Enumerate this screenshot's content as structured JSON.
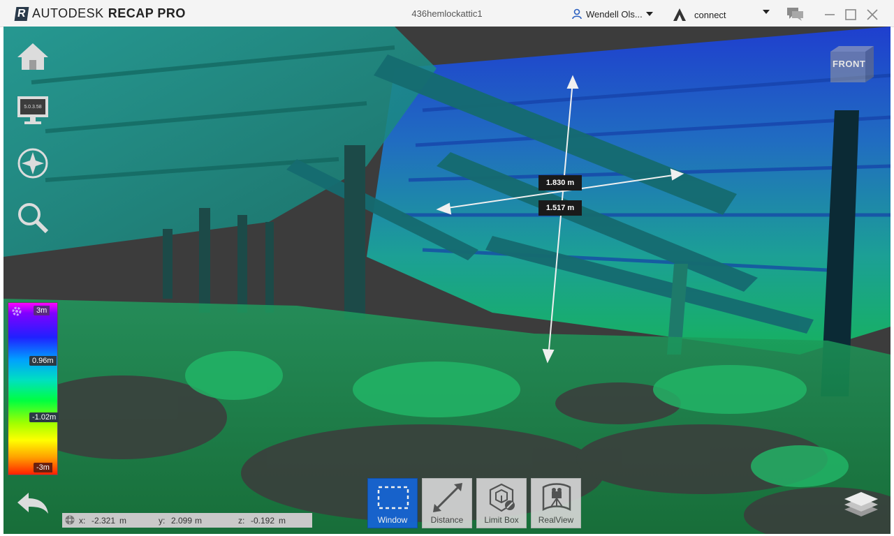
{
  "app": {
    "brand_logo": "R",
    "brand_primary": "AUTODESK",
    "brand_secondary": "RECAP PRO",
    "document_title": "436hemlockattic1"
  },
  "account": {
    "user_name": "Wendell Ols...",
    "connect_label": "connect"
  },
  "window_controls": [
    "minimize-icon",
    "maximize-icon",
    "close-icon"
  ],
  "left_toolbar": {
    "display_badge": "5.0.3.58",
    "icons": [
      "home-icon",
      "display-settings-icon",
      "navigation-compass-icon",
      "zoom-search-icon",
      "back-arrow-icon"
    ]
  },
  "view_cube": {
    "label": "FRONT"
  },
  "measurements": [
    {
      "value": "1.830 m"
    },
    {
      "value": "1.517 m"
    }
  ],
  "elevation_legend": {
    "labels": [
      "3m",
      "0.96m",
      "-1.02m",
      "-3m"
    ],
    "gradient": [
      "#ff00ff",
      "#8000ff",
      "#2020ff",
      "#00a0ff",
      "#00e0c0",
      "#00ff40",
      "#a0ff00",
      "#ffff00",
      "#ffa000",
      "#ff2000"
    ]
  },
  "coordinates": {
    "x_label": "x:",
    "x_value": "-2.321",
    "x_unit": "m",
    "y_label": "y:",
    "y_value": "2.099",
    "y_unit": "m",
    "z_label": "z:",
    "z_value": "-0.192",
    "z_unit": "m"
  },
  "bottom_toolbar": [
    {
      "label": "Window",
      "icon": "selection-window-icon",
      "active": true
    },
    {
      "label": "Distance",
      "icon": "distance-measure-icon",
      "active": false
    },
    {
      "label": "Limit Box",
      "icon": "limit-box-icon",
      "active": false
    },
    {
      "label": "RealView",
      "icon": "realview-icon",
      "active": false
    }
  ],
  "colors": {
    "accent": "#1565d8",
    "titlebar_bg": "#f4f4f4",
    "viewport_bg": "#3c3c3c"
  }
}
